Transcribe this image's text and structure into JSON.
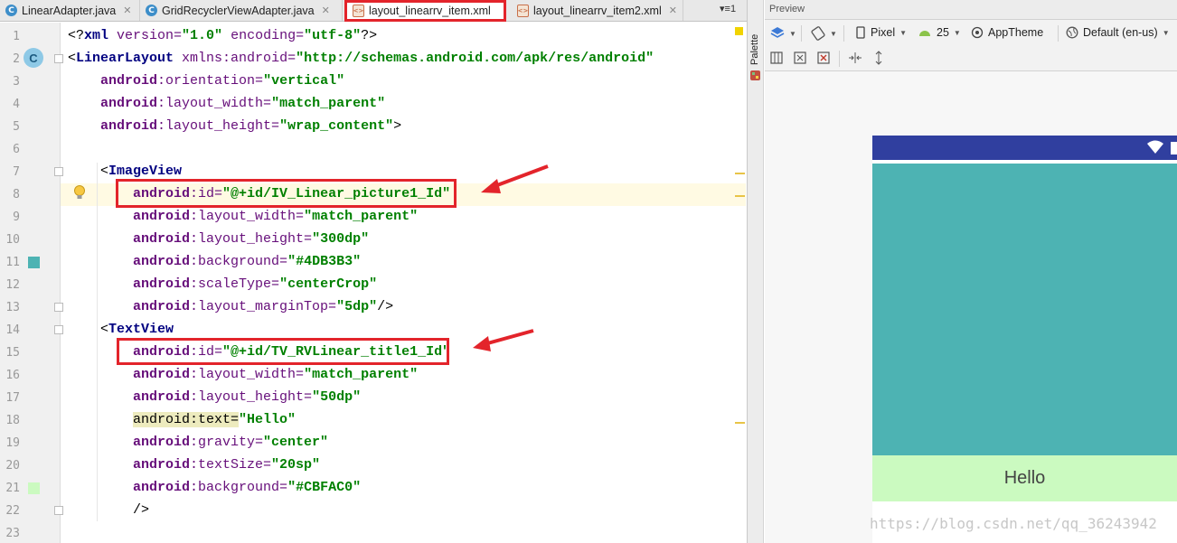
{
  "tabs": [
    {
      "label": "LinearAdapter.java",
      "icon": "class-c-icon"
    },
    {
      "label": "GridRecyclerViewAdapter.java",
      "icon": "class-c-icon"
    },
    {
      "label": "layout_linearrv_item.xml",
      "icon": "xml-file-icon"
    },
    {
      "label": "layout_linearrv_item2.xml",
      "icon": "xml-file-icon"
    }
  ],
  "tabs_overflow": "▾≡1",
  "editor": {
    "line_numbers": [
      "1",
      "2",
      "3",
      "4",
      "5",
      "6",
      "7",
      "8",
      "9",
      "10",
      "11",
      "12",
      "13",
      "14",
      "15",
      "16",
      "17",
      "18",
      "19",
      "20",
      "21",
      "22",
      "23"
    ],
    "gutter_badge": "C",
    "swatch_colors": {
      "image_bg": "#4DB3B3",
      "text_bg": "#CBFAC0"
    },
    "lines": [
      {
        "parts": [
          [
            "punct",
            "<?"
          ],
          [
            "tag",
            "xml "
          ],
          [
            "attr",
            "version="
          ],
          [
            "val",
            "\"1.0\""
          ],
          [
            "attr",
            " encoding="
          ],
          [
            "val",
            "\"utf-8\""
          ],
          [
            "punct",
            "?>"
          ]
        ]
      },
      {
        "parts": [
          [
            "punct",
            "<"
          ],
          [
            "tag",
            "LinearLayout "
          ],
          [
            "attr",
            "xmlns:android="
          ],
          [
            "val",
            "\"http://schemas.android.com/apk/res/android\""
          ]
        ]
      },
      {
        "parts": [
          [
            "punct",
            "    "
          ],
          [
            "ns",
            "android"
          ],
          [
            "attr",
            ":orientation="
          ],
          [
            "val",
            "\"vertical\""
          ]
        ]
      },
      {
        "parts": [
          [
            "punct",
            "    "
          ],
          [
            "ns",
            "android"
          ],
          [
            "attr",
            ":layout_width="
          ],
          [
            "val",
            "\"match_parent\""
          ]
        ]
      },
      {
        "parts": [
          [
            "punct",
            "    "
          ],
          [
            "ns",
            "android"
          ],
          [
            "attr",
            ":layout_height="
          ],
          [
            "val",
            "\"wrap_content\""
          ],
          [
            "punct",
            ">"
          ]
        ]
      },
      {
        "parts": []
      },
      {
        "parts": [
          [
            "punct",
            "    <"
          ],
          [
            "tag",
            "ImageView"
          ]
        ]
      },
      {
        "parts": [
          [
            "punct",
            "        "
          ],
          [
            "ns",
            "android"
          ],
          [
            "attr",
            ":id="
          ],
          [
            "val",
            "\"@+id/IV_Linear_picture1_Id\""
          ]
        ]
      },
      {
        "parts": [
          [
            "punct",
            "        "
          ],
          [
            "ns",
            "android"
          ],
          [
            "attr",
            ":layout_width="
          ],
          [
            "val",
            "\"match_parent\""
          ]
        ]
      },
      {
        "parts": [
          [
            "punct",
            "        "
          ],
          [
            "ns",
            "android"
          ],
          [
            "attr",
            ":layout_height="
          ],
          [
            "val",
            "\"300dp\""
          ]
        ]
      },
      {
        "parts": [
          [
            "punct",
            "        "
          ],
          [
            "ns",
            "android"
          ],
          [
            "attr",
            ":background="
          ],
          [
            "val",
            "\"#4DB3B3\""
          ]
        ]
      },
      {
        "parts": [
          [
            "punct",
            "        "
          ],
          [
            "ns",
            "android"
          ],
          [
            "attr",
            ":scaleType="
          ],
          [
            "val",
            "\"centerCrop\""
          ]
        ]
      },
      {
        "parts": [
          [
            "punct",
            "        "
          ],
          [
            "ns",
            "android"
          ],
          [
            "attr",
            ":layout_marginTop="
          ],
          [
            "val",
            "\"5dp\""
          ],
          [
            "punct",
            "/>"
          ]
        ]
      },
      {
        "parts": [
          [
            "punct",
            "    <"
          ],
          [
            "tag",
            "TextView"
          ]
        ]
      },
      {
        "parts": [
          [
            "punct",
            "        "
          ],
          [
            "ns",
            "android"
          ],
          [
            "attr",
            ":id="
          ],
          [
            "val",
            "\"@+id/TV_RVLinear_title1_Id\""
          ]
        ]
      },
      {
        "parts": [
          [
            "punct",
            "        "
          ],
          [
            "ns",
            "android"
          ],
          [
            "attr",
            ":layout_width="
          ],
          [
            "val",
            "\"match_parent\""
          ]
        ]
      },
      {
        "parts": [
          [
            "punct",
            "        "
          ],
          [
            "ns",
            "android"
          ],
          [
            "attr",
            ":layout_height="
          ],
          [
            "val",
            "\"50dp\""
          ]
        ]
      },
      {
        "parts": [
          [
            "punct",
            "        "
          ],
          [
            "hl",
            "android:text="
          ],
          [
            "val",
            "\"Hello\""
          ]
        ]
      },
      {
        "parts": [
          [
            "punct",
            "        "
          ],
          [
            "ns",
            "android"
          ],
          [
            "attr",
            ":gravity="
          ],
          [
            "val",
            "\"center\""
          ]
        ]
      },
      {
        "parts": [
          [
            "punct",
            "        "
          ],
          [
            "ns",
            "android"
          ],
          [
            "attr",
            ":textSize="
          ],
          [
            "val",
            "\"20sp\""
          ]
        ]
      },
      {
        "parts": [
          [
            "punct",
            "        "
          ],
          [
            "ns",
            "android"
          ],
          [
            "attr",
            ":background="
          ],
          [
            "val",
            "\"#CBFAC0\""
          ]
        ]
      },
      {
        "parts": [
          [
            "punct",
            "        />"
          ]
        ]
      },
      {
        "parts": []
      }
    ]
  },
  "palette_label": "Palette",
  "preview": {
    "title": "Preview",
    "device": "Pixel",
    "api": "25",
    "theme": "AppTheme",
    "locale": "Default (en-us)",
    "textview_text": "Hello",
    "imageview_color": "#4DB3B3",
    "textview_color": "#CBFAC0",
    "statusbar_color": "#303F9F"
  },
  "watermark": "https://blog.csdn.net/qq_36243942"
}
